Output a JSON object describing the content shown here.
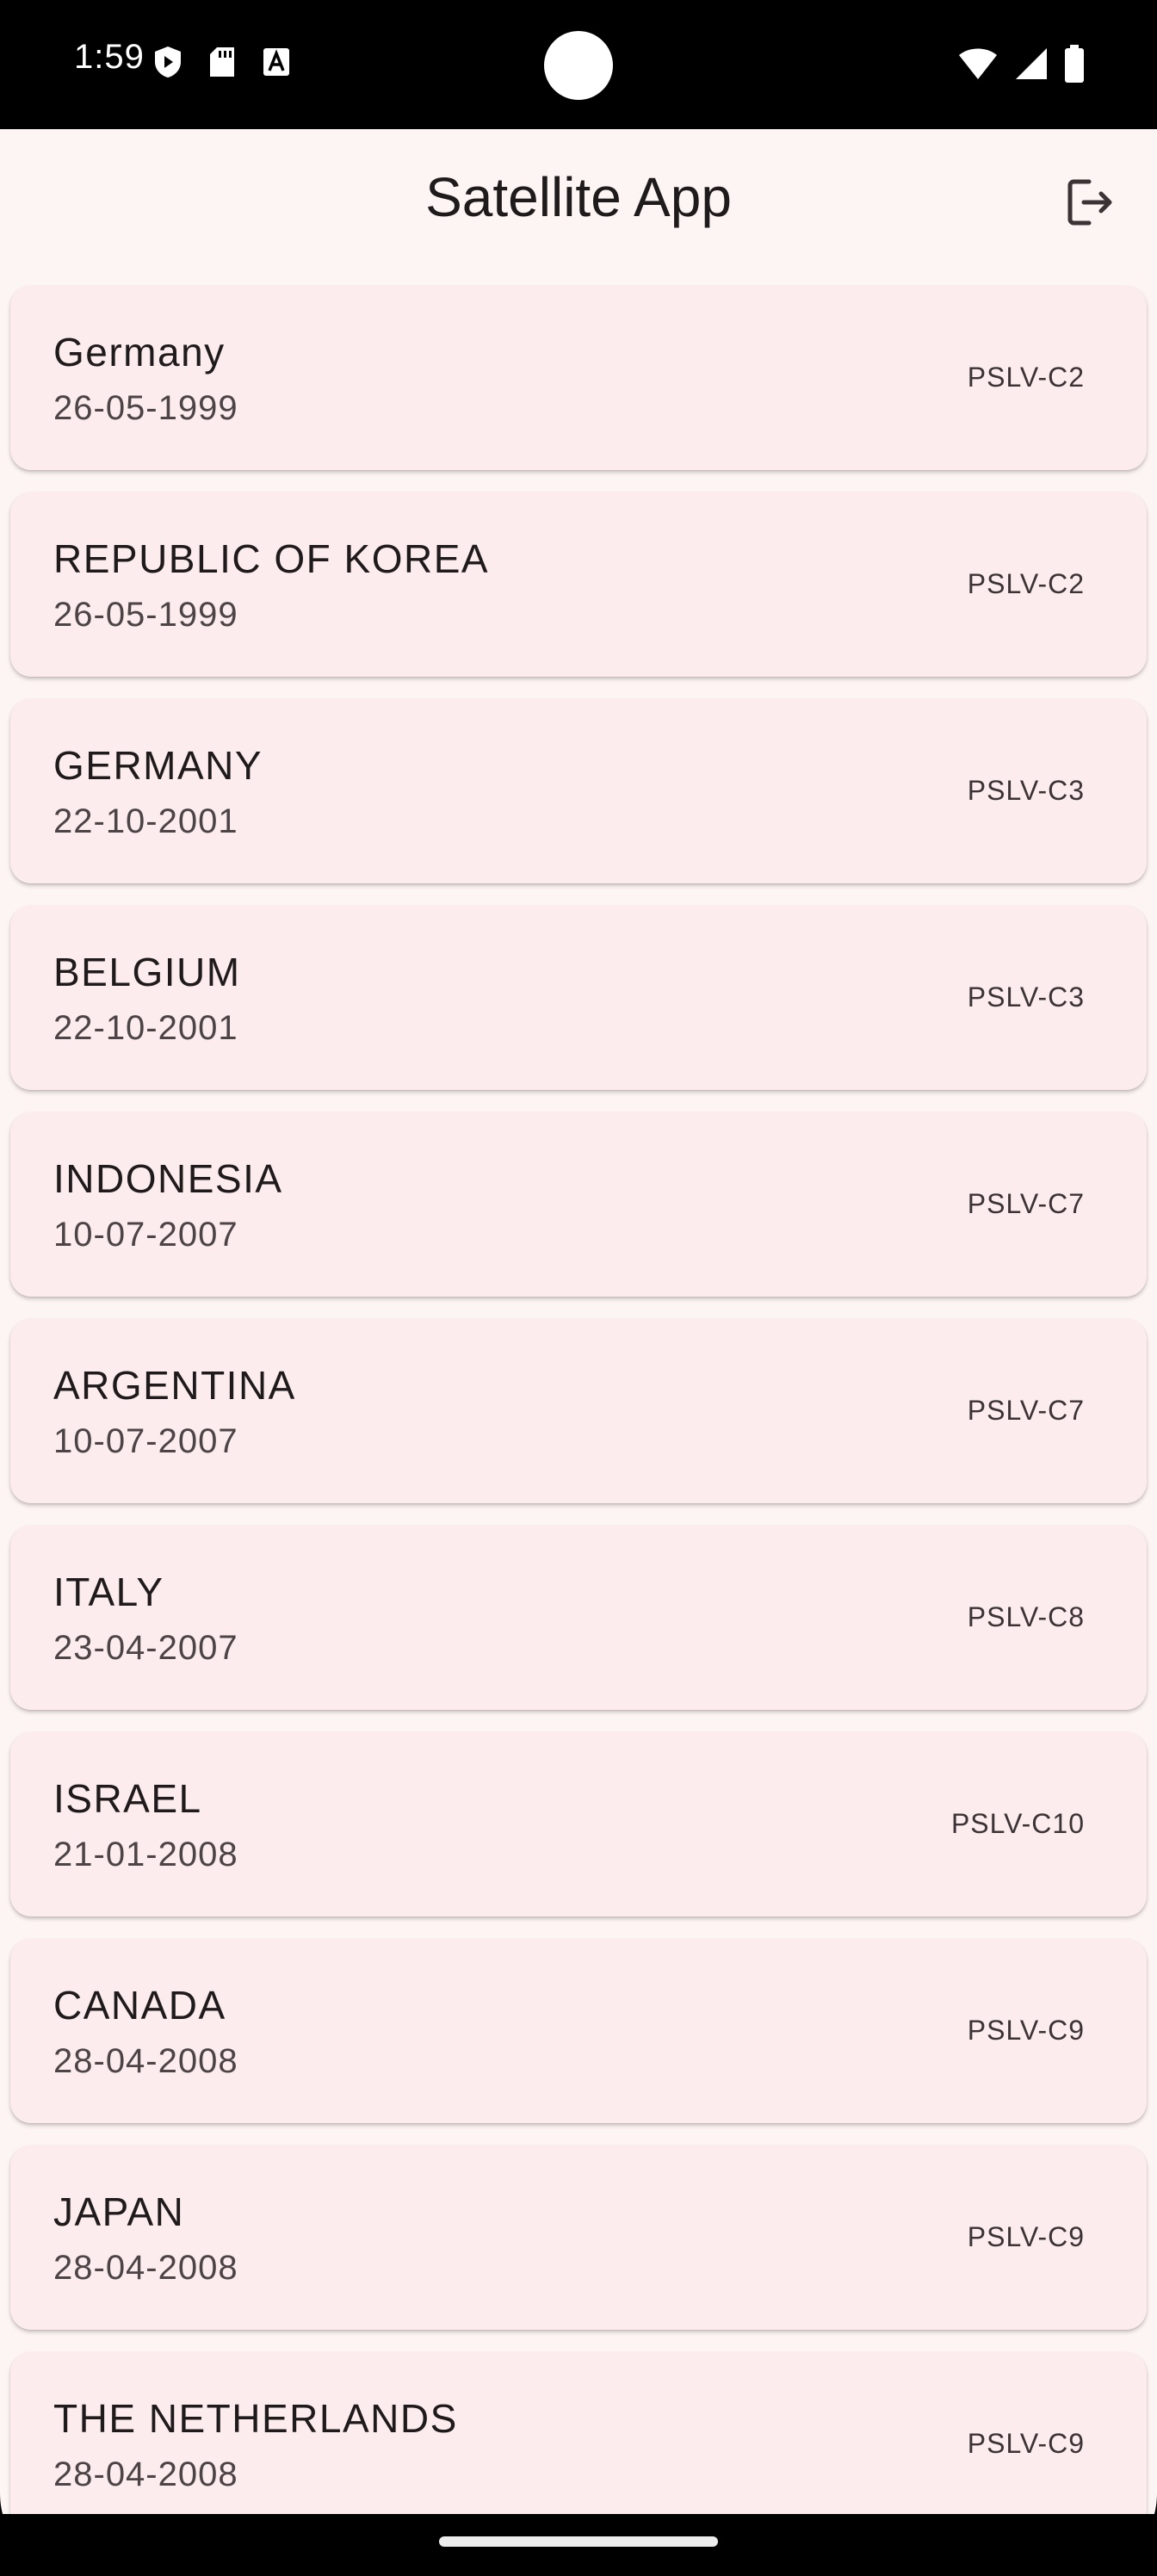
{
  "status_bar": {
    "time": "1:59"
  },
  "app": {
    "title": "Satellite App",
    "logout_icon": "logout-icon"
  },
  "satellites": [
    {
      "country": "Germany",
      "date": "26-05-1999",
      "vehicle": "PSLV-C2"
    },
    {
      "country": "REPUBLIC OF KOREA",
      "date": "26-05-1999",
      "vehicle": "PSLV-C2"
    },
    {
      "country": "GERMANY",
      "date": "22-10-2001",
      "vehicle": "PSLV-C3"
    },
    {
      "country": "BELGIUM",
      "date": "22-10-2001",
      "vehicle": "PSLV-C3"
    },
    {
      "country": "INDONESIA",
      "date": "10-07-2007",
      "vehicle": "PSLV-C7"
    },
    {
      "country": "ARGENTINA",
      "date": "10-07-2007",
      "vehicle": "PSLV-C7"
    },
    {
      "country": "ITALY",
      "date": "23-04-2007",
      "vehicle": "PSLV-C8"
    },
    {
      "country": "ISRAEL",
      "date": "21-01-2008",
      "vehicle": "PSLV-C10"
    },
    {
      "country": "CANADA",
      "date": "28-04-2008",
      "vehicle": "PSLV-C9"
    },
    {
      "country": "JAPAN",
      "date": "28-04-2008",
      "vehicle": "PSLV-C9"
    },
    {
      "country": "THE NETHERLANDS",
      "date": "28-04-2008",
      "vehicle": "PSLV-C9"
    }
  ]
}
